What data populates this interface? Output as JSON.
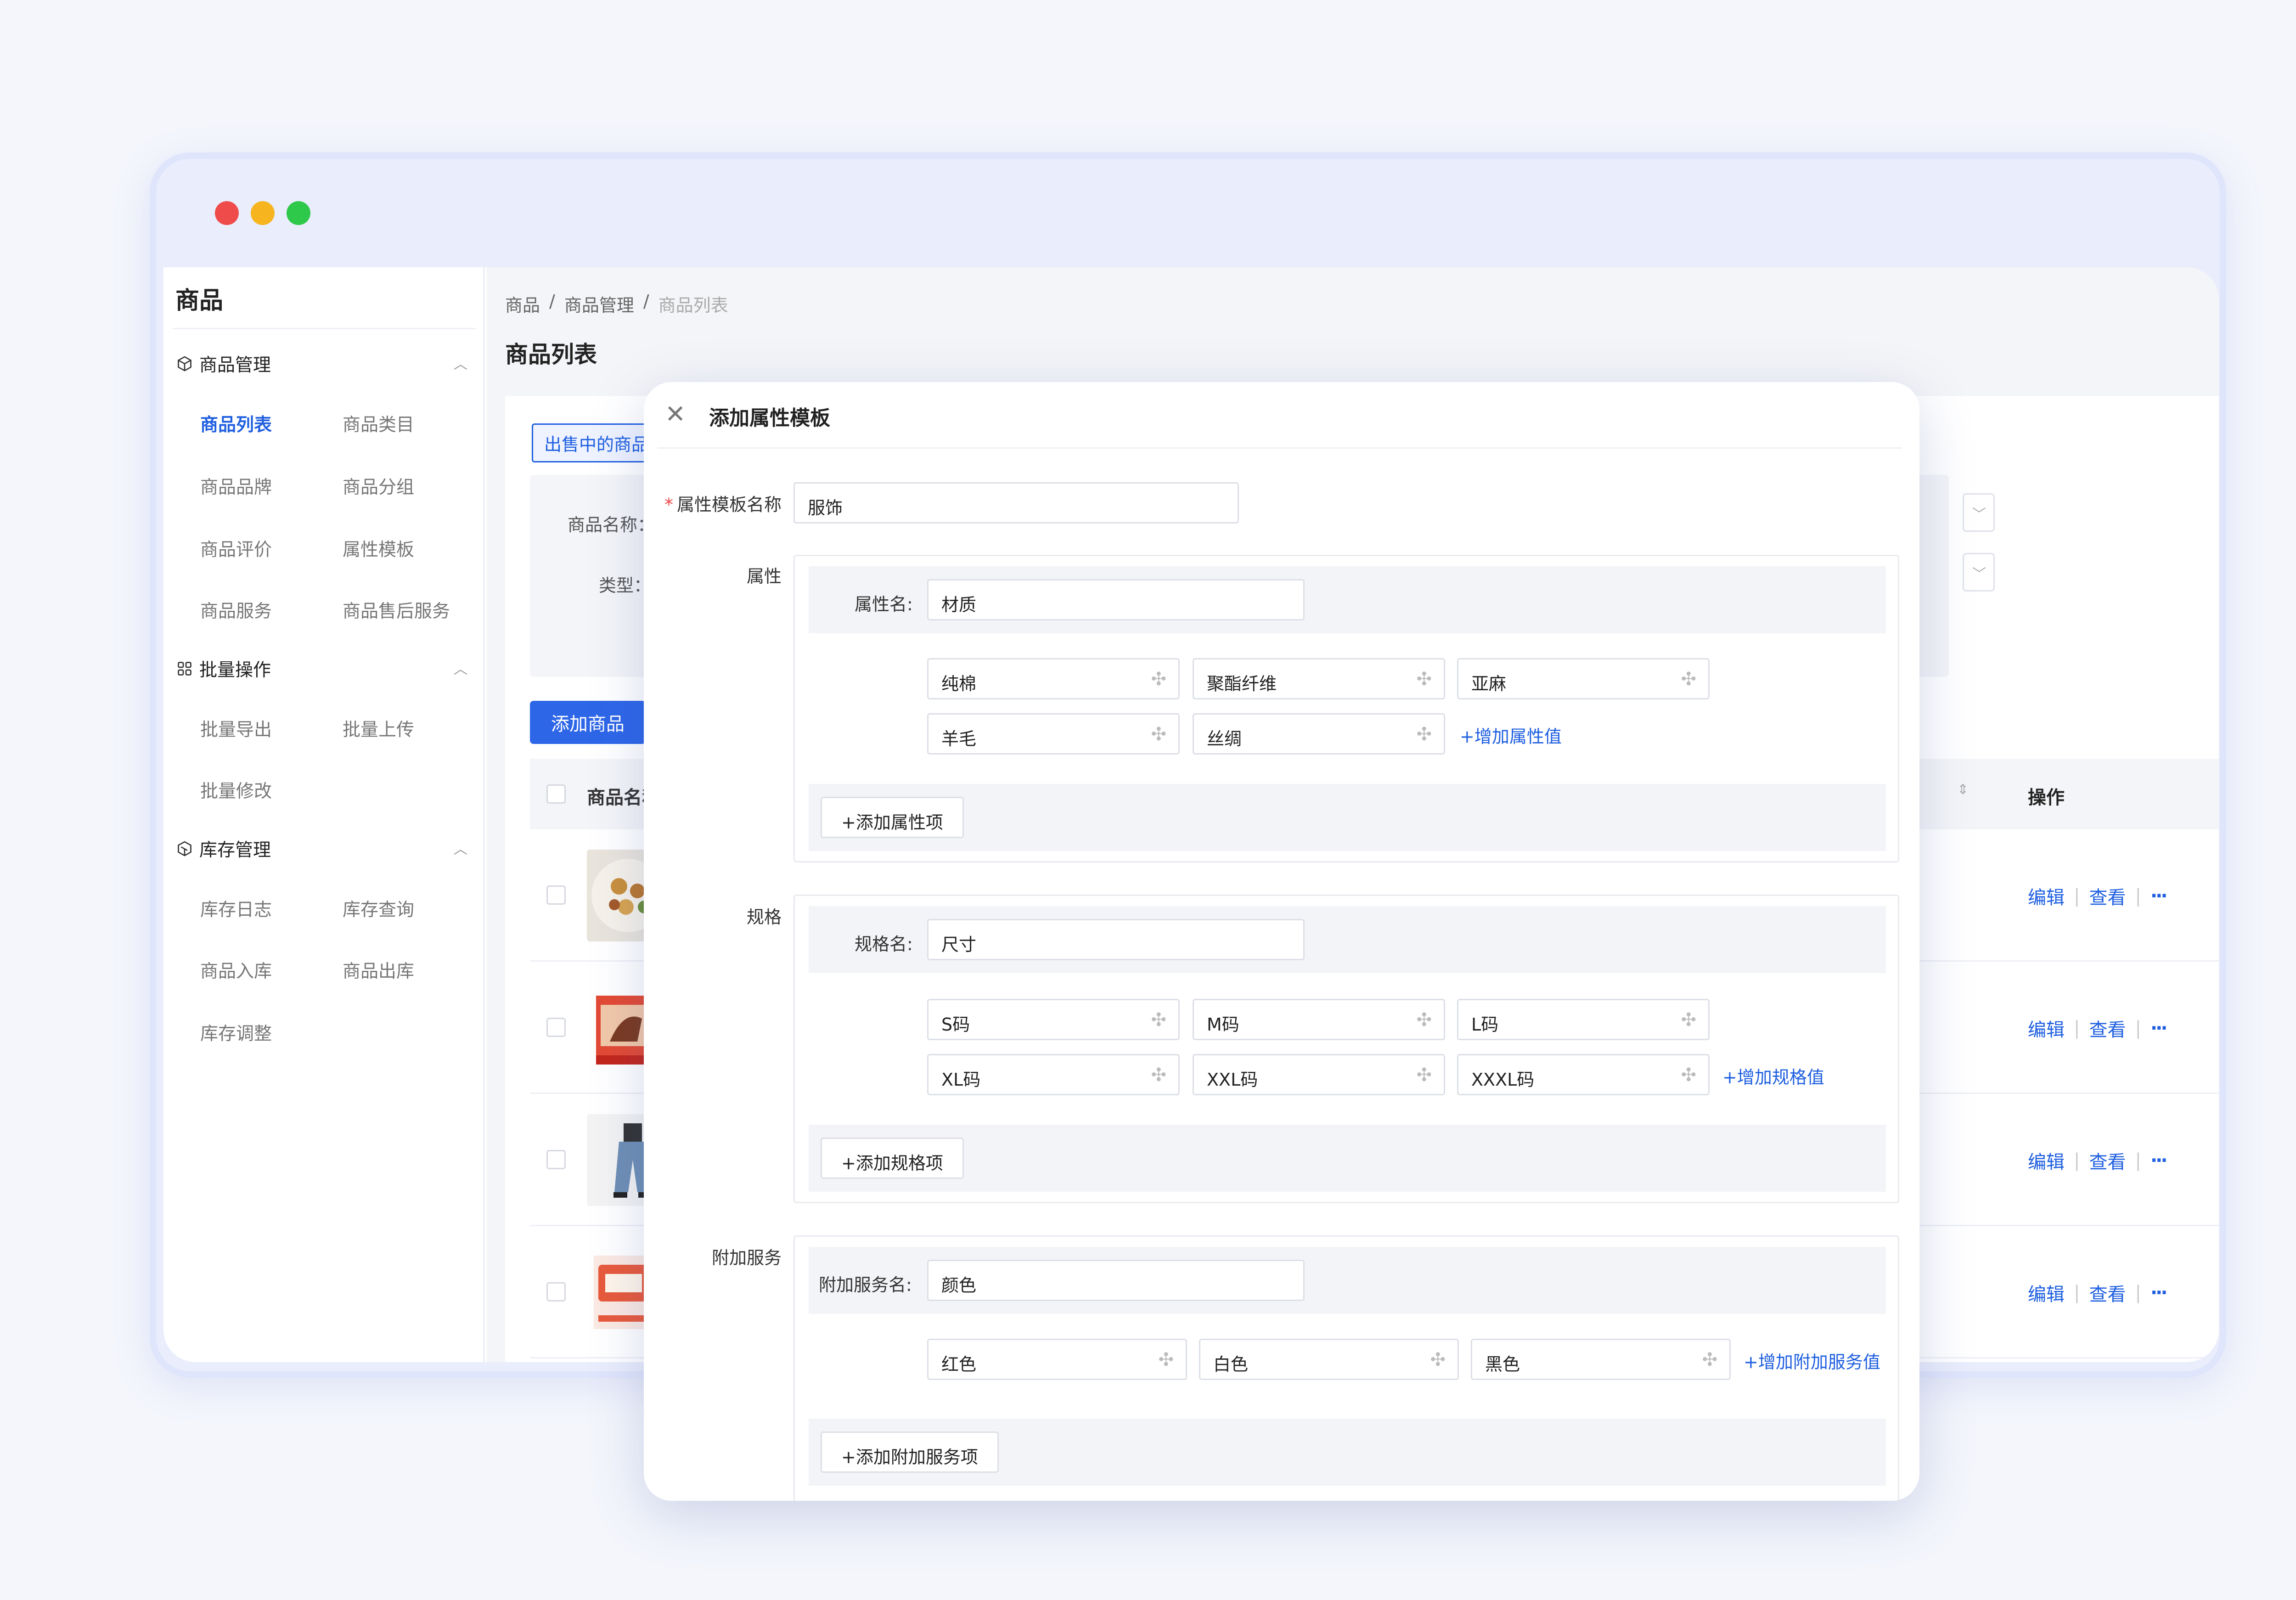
{
  "sidebar": {
    "title": "商品",
    "groups": [
      {
        "label": "商品管理",
        "items": [
          "商品列表",
          "商品类目",
          "商品品牌",
          "商品分组",
          "商品评价",
          "属性模板",
          "商品服务",
          "商品售后服务"
        ]
      },
      {
        "label": "批量操作",
        "items": [
          "批量导出",
          "批量上传",
          "批量修改"
        ]
      },
      {
        "label": "库存管理",
        "items": [
          "库存日志",
          "库存查询",
          "商品入库",
          "商品出库",
          "库存调整"
        ]
      }
    ],
    "active_item": "商品列表"
  },
  "breadcrumb": [
    "商品",
    "/",
    "商品管理",
    "/",
    "商品列表"
  ],
  "page_title": "商品列表",
  "main": {
    "tab": "出售中的商品",
    "filters": {
      "name_label": "商品名称：",
      "type_label": "类型："
    },
    "add_button": "添加商品",
    "table": {
      "col_name": "商品名称",
      "col_ops": "操作",
      "row_ops": {
        "edit": "编辑",
        "view": "查看",
        "sep": "|",
        "more": "···"
      }
    }
  },
  "modal": {
    "title": "添加属性模板",
    "template_name_label": "属性模板名称",
    "template_name_value": "服饰",
    "attribute": {
      "section_label": "属性",
      "name_label": "属性名:",
      "name_value": "材质",
      "values": [
        "纯棉",
        "聚酯纤维",
        "亚麻",
        "羊毛",
        "丝绸"
      ],
      "add_value_link": "+增加属性值",
      "add_item_button": "+添加属性项"
    },
    "spec": {
      "section_label": "规格",
      "name_label": "规格名:",
      "name_value": "尺寸",
      "values": [
        "S码",
        "M码",
        "L码",
        "XL码",
        "XXL码",
        "XXXL码"
      ],
      "add_value_link": "+增加规格值",
      "add_item_button": "+添加规格项"
    },
    "service": {
      "section_label": "附加服务",
      "name_label": "附加服务名:",
      "name_value": "颜色",
      "values": [
        "红色",
        "白色",
        "黑色"
      ],
      "add_value_link": "+增加附加服务值",
      "add_item_button": "+添加附加服务项"
    }
  },
  "colors": {
    "accent": "#1f5fe0",
    "primary_button": "#2e66e8",
    "required": "#e64545"
  },
  "icons": {
    "close": "close-icon",
    "drag": "drag-handle-icon",
    "chevron": "chevron-up-icon",
    "box": "box-icon",
    "grid": "grid-icon",
    "stock": "stock-icon"
  }
}
